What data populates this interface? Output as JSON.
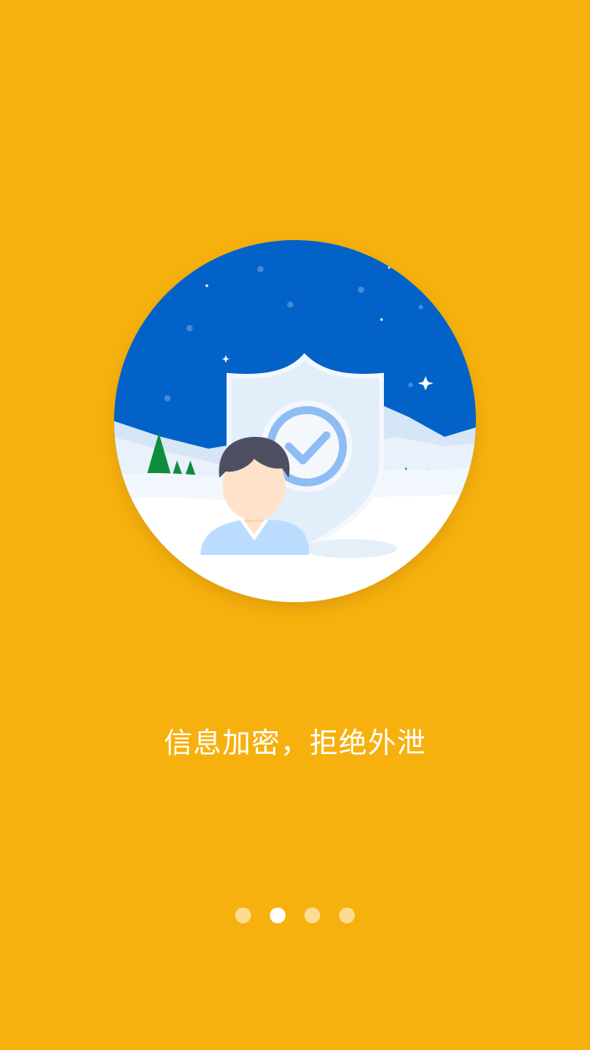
{
  "onboarding": {
    "caption": "信息加密，拒绝外泄",
    "illustration": {
      "icon": "user-shield-icon"
    },
    "pager": {
      "total": 4,
      "current_index": 1
    }
  },
  "colors": {
    "background": "#F6B10E",
    "sky": "#0362C8",
    "snow": "#FFFFFF",
    "shield": "#E3EEFB",
    "check": "#8DBDF2",
    "tree": "#0E8D3D",
    "hair": "#4F4F62",
    "shirt": "#BBDCFF",
    "skin": "#FEE3CA",
    "dot_inactive": "rgba(255,255,255,0.55)",
    "dot_active": "#FFFFFF"
  }
}
